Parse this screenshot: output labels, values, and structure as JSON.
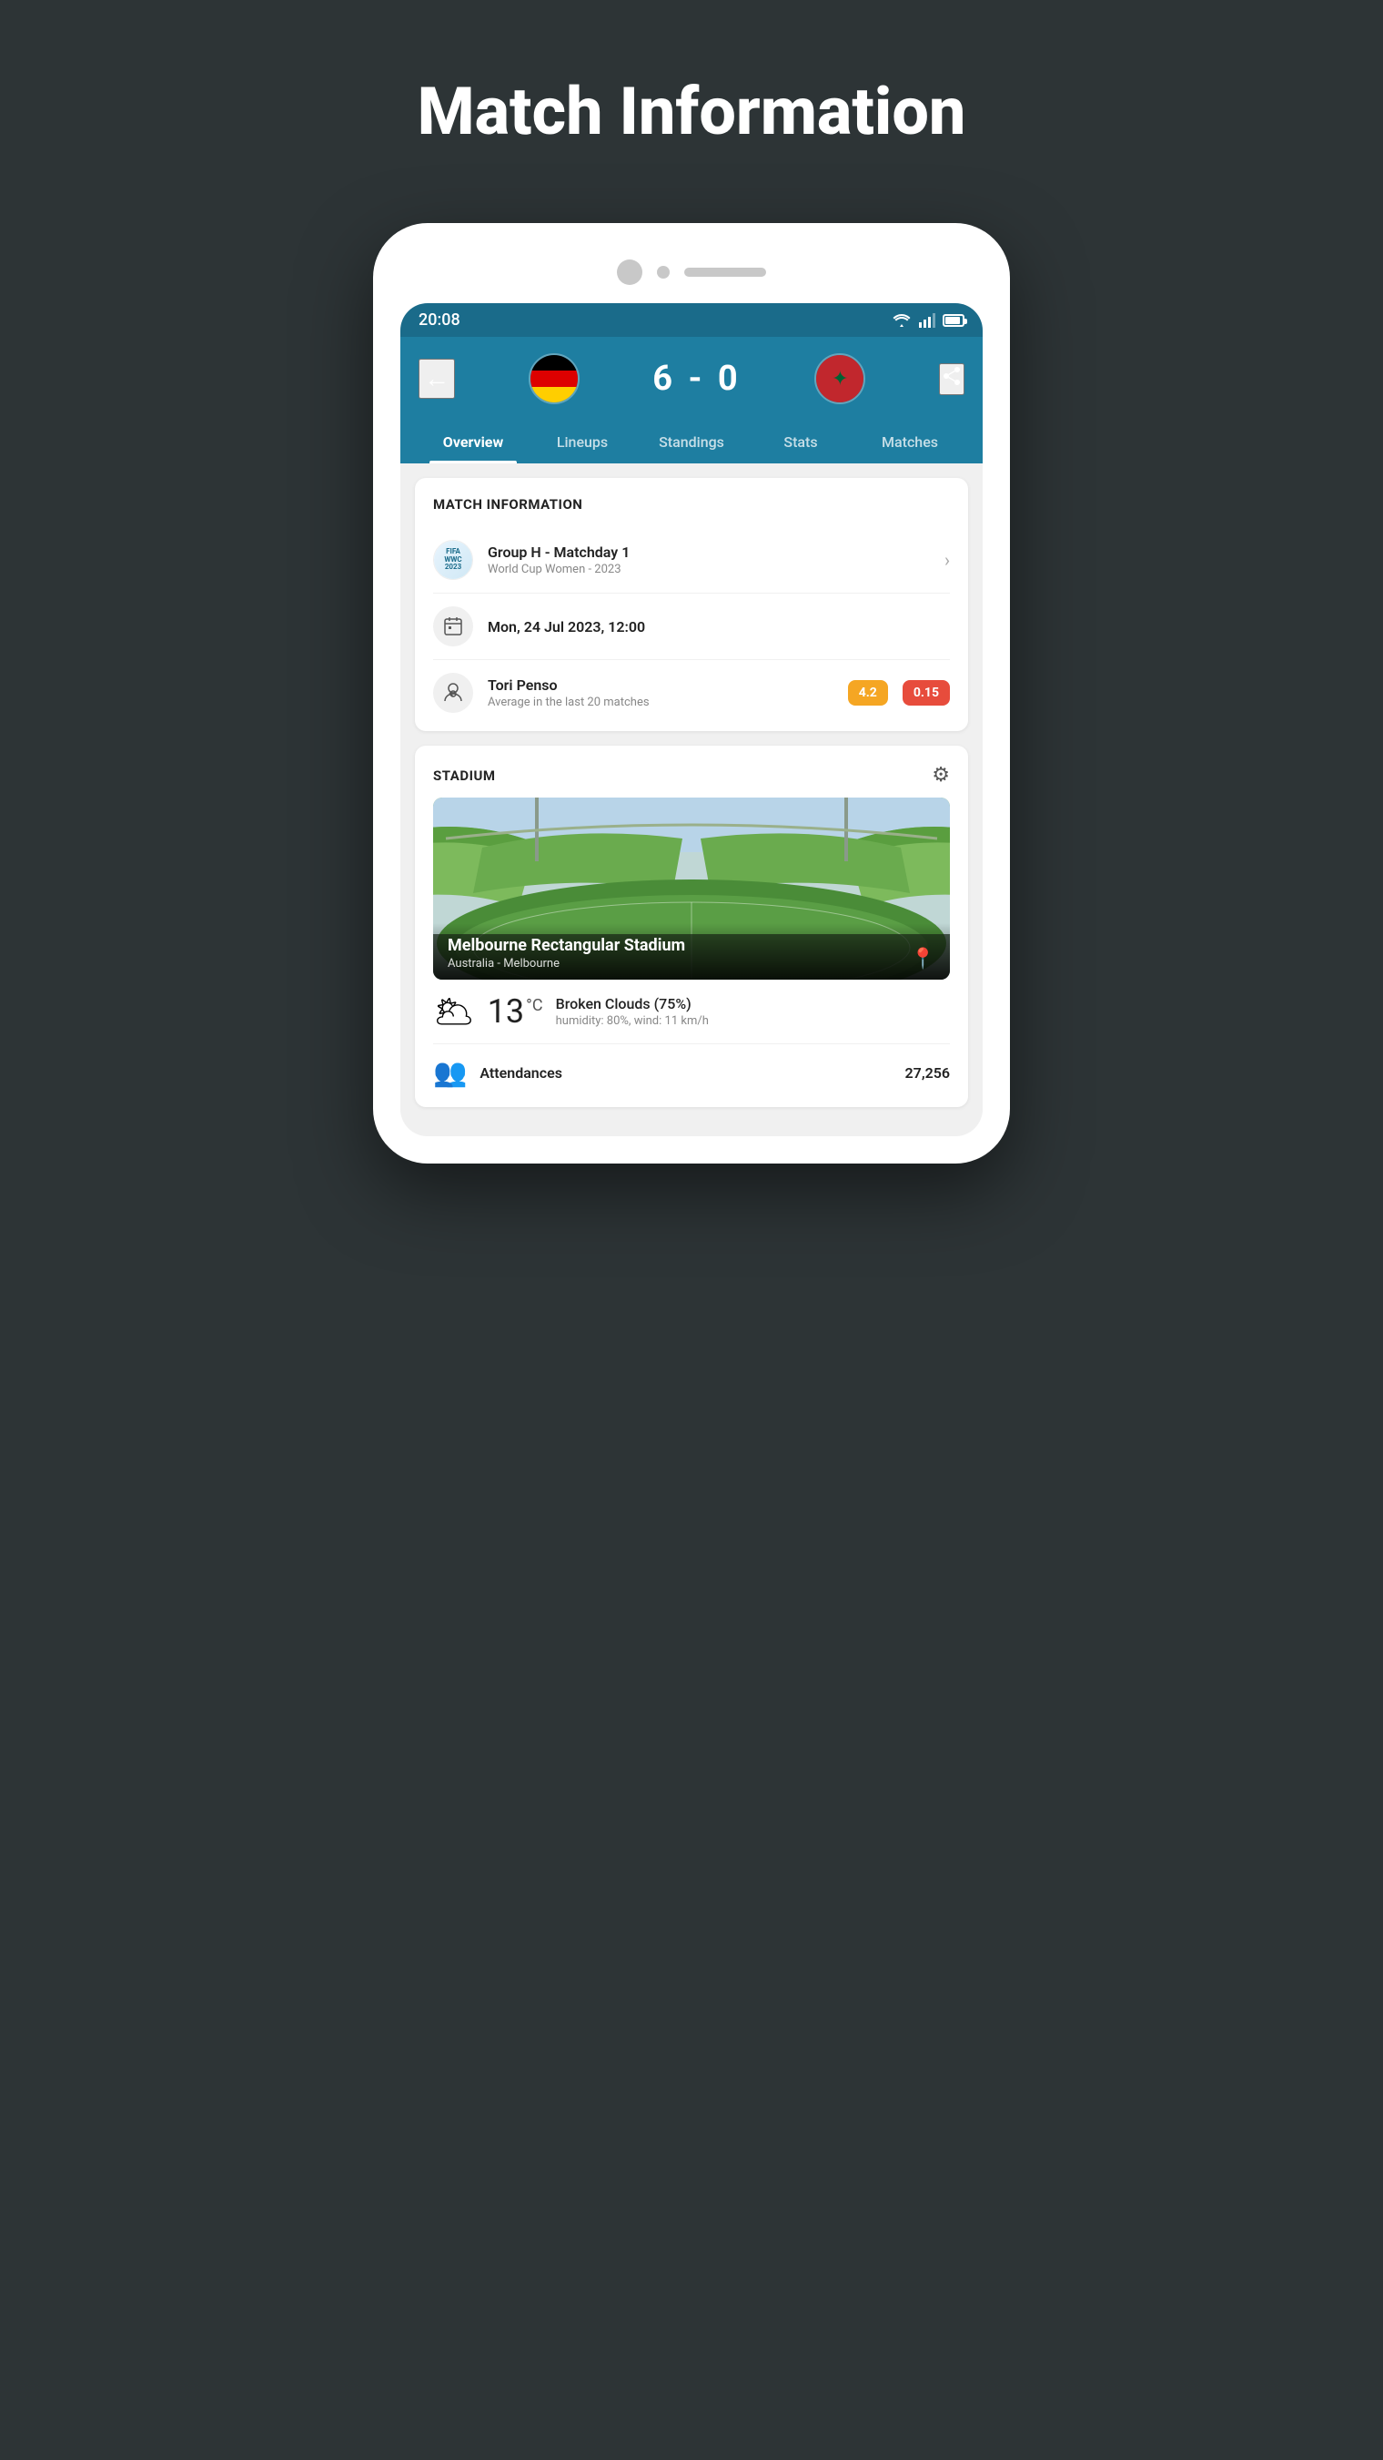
{
  "page": {
    "title": "Match Information"
  },
  "status_bar": {
    "time": "20:08"
  },
  "header": {
    "score": "6 - 0",
    "back_label": "←",
    "share_label": "⋮"
  },
  "nav_tabs": [
    {
      "id": "overview",
      "label": "Overview",
      "active": true
    },
    {
      "id": "lineups",
      "label": "Lineups",
      "active": false
    },
    {
      "id": "standings",
      "label": "Standings",
      "active": false
    },
    {
      "id": "stats",
      "label": "Stats",
      "active": false
    },
    {
      "id": "matches",
      "label": "Matches",
      "active": false
    }
  ],
  "match_info": {
    "section_title": "MATCH INFORMATION",
    "tournament": {
      "name": "Group H - Matchday 1",
      "competition": "World Cup Women - 2023"
    },
    "date": {
      "value": "Mon, 24 Jul 2023, 12:00"
    },
    "referee": {
      "name": "Tori Penso",
      "subtitle": "Average in the last 20 matches",
      "badge_yellow": "4.2",
      "badge_red": "0.15"
    }
  },
  "stadium": {
    "section_title": "STADIUM",
    "name": "Melbourne Rectangular Stadium",
    "location": "Australia - Melbourne"
  },
  "weather": {
    "temperature": "13",
    "unit": "°C",
    "condition": "Broken Clouds (75%)",
    "details": "humidity: 80%, wind: 11 km/h"
  },
  "attendance": {
    "label": "Attendances",
    "value": "27,256"
  }
}
